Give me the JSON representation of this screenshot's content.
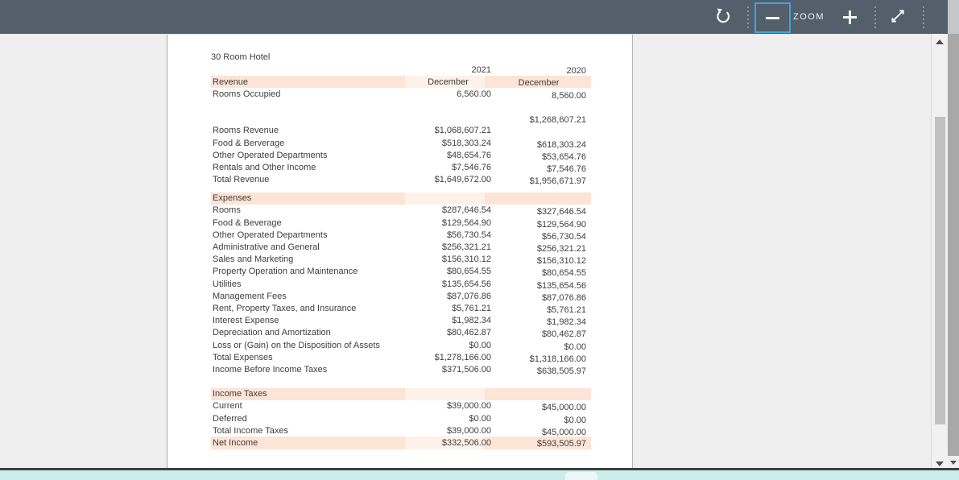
{
  "toolbar": {
    "refresh_icon": "circular-reset-arrow",
    "zoom_label": "ZOOM",
    "zoom_out_glyph": "minus",
    "zoom_in_glyph": "plus",
    "expand_icon": "diagonal-resize-arrows",
    "colors": {
      "background": "#535f6a",
      "focus_border": "#3ba7e0",
      "icon": "#f2f5f6"
    }
  },
  "scrollbars": {
    "vertical_up_icon": "triangle-up",
    "vertical_down_icon": "triangle-down",
    "outer_down_icon": "triangle-down"
  },
  "bottom_bar": {
    "color": "#cdedea"
  },
  "document": {
    "title": "30 Room Hotel",
    "years": [
      "2021",
      "2020"
    ],
    "period_label": "December",
    "header_band_label": "Revenue",
    "colors": {
      "band": "#fce4d6",
      "band_light": "#fdf1e9",
      "text": "#3e3e3e",
      "page": "#ffffff"
    },
    "rows": [
      {
        "type": "row",
        "label": "Rooms Occupied",
        "y2021": "6,560.00",
        "y2020": "8,560.00"
      },
      {
        "type": "blank",
        "label": "",
        "y2021": "",
        "y2020": ""
      },
      {
        "type": "row",
        "label": "",
        "y2021": "",
        "y2020": "$1,268,607.21"
      },
      {
        "type": "row",
        "label": "Rooms Revenue",
        "y2021": "$1,068,607.21",
        "y2020": ""
      },
      {
        "type": "row",
        "label": "Food & Berverage",
        "y2021": "$518,303.24",
        "y2020": "$618,303.24"
      },
      {
        "type": "row",
        "label": "Other Operated Departments",
        "y2021": "$48,654.76",
        "y2020": "$53,654.76"
      },
      {
        "type": "row",
        "label": "Rentals and Other Income",
        "y2021": "$7,546.76",
        "y2020": "$7,546.76"
      },
      {
        "type": "row",
        "label": "Total Revenue",
        "y2021": "$1,649,672.00",
        "y2020": "$1,956,671.97"
      },
      {
        "type": "blank_sm",
        "label": "",
        "y2021": "",
        "y2020": ""
      },
      {
        "type": "band",
        "label": "Expenses",
        "y2021": "",
        "y2020": ""
      },
      {
        "type": "row",
        "label": "Rooms",
        "y2021": "$287,646.54",
        "y2020": "$327,646.54"
      },
      {
        "type": "row",
        "label": "Food & Beverage",
        "y2021": "$129,564.90",
        "y2020": "$129,564.90"
      },
      {
        "type": "row",
        "label": "Other Operated Departments",
        "y2021": "$56,730.54",
        "y2020": "$56,730.54"
      },
      {
        "type": "row",
        "label": "Administrative and General",
        "y2021": "$256,321.21",
        "y2020": "$256,321.21"
      },
      {
        "type": "row",
        "label": "Sales and Marketing",
        "y2021": "$156,310.12",
        "y2020": "$156,310.12"
      },
      {
        "type": "row",
        "label": "Property Operation and Maintenance",
        "y2021": "$80,654.55",
        "y2020": "$80,654.55"
      },
      {
        "type": "row",
        "label": "Utilities",
        "y2021": "$135,654.56",
        "y2020": "$135,654.56"
      },
      {
        "type": "row",
        "label": "Management Fees",
        "y2021": "$87,076.86",
        "y2020": "$87,076.86"
      },
      {
        "type": "row",
        "label": "Rent, Property Taxes, and Insurance",
        "y2021": "$5,761.21",
        "y2020": "$5,761.21"
      },
      {
        "type": "row",
        "label": "Interest Expense",
        "y2021": "$1,982.34",
        "y2020": "$1,982.34"
      },
      {
        "type": "row",
        "label": "Depreciation and Amortization",
        "y2021": "$80,462.87",
        "y2020": "$80,462.87"
      },
      {
        "type": "row",
        "label": "Loss or (Gain) on the Disposition of Assets",
        "y2021": "$0.00",
        "y2020": "$0.00"
      },
      {
        "type": "row",
        "label": "Total Expenses",
        "y2021": "$1,278,166.00",
        "y2020": "$1,318,166.00"
      },
      {
        "type": "row",
        "label": "Income Before Income Taxes",
        "y2021": "$371,506.00",
        "y2020": "$638,505.97"
      },
      {
        "type": "blank",
        "label": "",
        "y2021": "",
        "y2020": ""
      },
      {
        "type": "band",
        "label": "Income Taxes",
        "y2021": "",
        "y2020": ""
      },
      {
        "type": "row",
        "label": "Current",
        "y2021": "$39,000.00",
        "y2020": "$45,000.00"
      },
      {
        "type": "row",
        "label": "Deferred",
        "y2021": "$0.00",
        "y2020": "$0.00"
      },
      {
        "type": "row",
        "label": "Total Income Taxes",
        "y2021": "$39,000.00",
        "y2020": "$45,000.00"
      },
      {
        "type": "band_row",
        "label": "Net Income",
        "y2021": "$332,506.00",
        "y2020": "$593,505.97"
      }
    ]
  }
}
